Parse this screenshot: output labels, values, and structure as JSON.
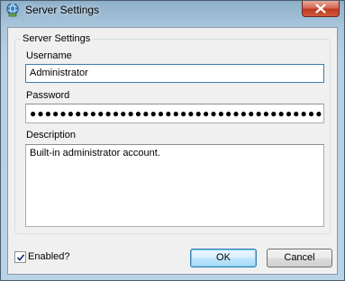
{
  "window": {
    "title": "Server Settings"
  },
  "groupbox": {
    "legend": "Server Settings"
  },
  "username": {
    "label": "Username",
    "value": "Administrator"
  },
  "password": {
    "label": "Password",
    "masked_value": "●●●●●●●●●●●●●●●●●●●●●●●●●●●●●●●●●●●●●●●●"
  },
  "description": {
    "label": "Description",
    "value": "Built-in administrator account."
  },
  "enabled": {
    "label": "Enabled?",
    "checked": true
  },
  "buttons": {
    "ok_label": "OK",
    "cancel_label": "Cancel"
  },
  "icons": {
    "app": "globe-server-icon",
    "close": "close-icon",
    "check": "checkmark-icon"
  },
  "colors": {
    "title_gradient_top": "#8fb0c9",
    "close_button": "#c0391d",
    "focus_border": "#3d7bad",
    "default_button": "#bee6fd"
  }
}
